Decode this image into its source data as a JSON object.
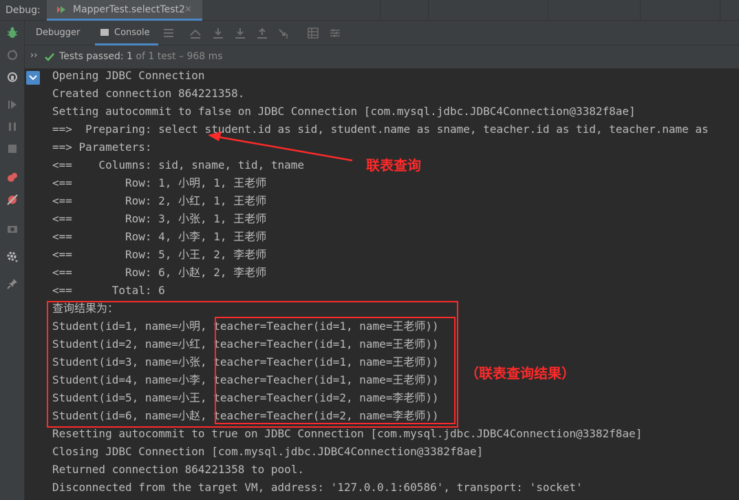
{
  "topbar": {
    "debug_label": "Debug:",
    "tab_title": "MapperTest.selectTest2",
    "tab_close": "×"
  },
  "toolbar": {
    "debugger_label": "Debugger",
    "console_label": "Console"
  },
  "status": {
    "expand": "››",
    "passed": "Tests passed: 1",
    "detail": " of 1 test – 968 ms"
  },
  "console": {
    "lines": [
      "Opening JDBC Connection",
      "Created connection 864221358.",
      "Setting autocommit to false on JDBC Connection [com.mysql.jdbc.JDBC4Connection@3382f8ae]",
      "==>  Preparing: select student.id as sid, student.name as sname, teacher.id as tid, teacher.name as",
      "==> Parameters: ",
      "<==    Columns: sid, sname, tid, tname",
      "<==        Row: 1, 小明, 1, 王老师",
      "<==        Row: 2, 小红, 1, 王老师",
      "<==        Row: 3, 小张, 1, 王老师",
      "<==        Row: 4, 小李, 1, 王老师",
      "<==        Row: 5, 小王, 2, 李老师",
      "<==        Row: 6, 小赵, 2, 李老师",
      "<==      Total: 6",
      "查询结果为：",
      "Student(id=1, name=小明, teacher=Teacher(id=1, name=王老师))",
      "Student(id=2, name=小红, teacher=Teacher(id=1, name=王老师))",
      "Student(id=3, name=小张, teacher=Teacher(id=1, name=王老师))",
      "Student(id=4, name=小李, teacher=Teacher(id=1, name=王老师))",
      "Student(id=5, name=小王, teacher=Teacher(id=2, name=李老师))",
      "Student(id=6, name=小赵, teacher=Teacher(id=2, name=李老师))",
      "Resetting autocommit to true on JDBC Connection [com.mysql.jdbc.JDBC4Connection@3382f8ae]",
      "Closing JDBC Connection [com.mysql.jdbc.JDBC4Connection@3382f8ae]",
      "Returned connection 864221358 to pool.",
      "Disconnected from the target VM, address: '127.0.0.1:60586', transport: 'socket'"
    ]
  },
  "annotations": {
    "join_query": "联表查询",
    "join_result": "（联表查询结果）",
    "color": "#ff2a2a"
  },
  "colors": {
    "background": "#2b2b2b",
    "panel": "#3c3f41",
    "accent": "#4a88c7",
    "success": "#5fb85f"
  }
}
